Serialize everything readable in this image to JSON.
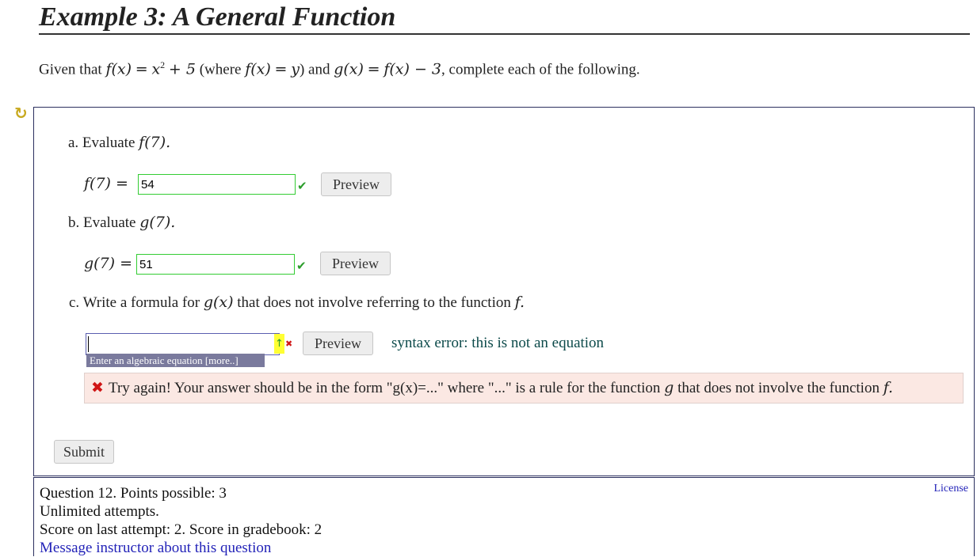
{
  "heading": "Example 3: A General Function",
  "intro": {
    "given": "Given that",
    "f_def_lhs": "f(x)",
    "f_def_rhs_base": "x",
    "f_def_exp": "2",
    "f_def_rhs_rest": "+ 5",
    "where_open": "(where",
    "where_lhs": "f(x)",
    "where_rhs": "y",
    "and": ") and",
    "g_def_lhs": "g(x)",
    "g_def_rhs": "f(x) − 3",
    "tail": ", complete each of the following."
  },
  "icons": {
    "refresh": "refresh-icon",
    "check": "check-icon",
    "cross": "cross-icon",
    "arrow": "up-arrow-icon"
  },
  "part_a": {
    "label_prefix": "a. Evaluate",
    "label_math": "f(7).",
    "eq_label": "f(7) =",
    "value": "54",
    "preview_label": "Preview"
  },
  "part_b": {
    "label_prefix": "b. Evaluate",
    "label_math": "g(7).",
    "eq_label": "g(7) =",
    "value": "51",
    "preview_label": "Preview"
  },
  "part_c": {
    "label_prefix": "c. Write a formula for",
    "label_math": "g(x)",
    "label_mid": "that does not involve referring to the function",
    "label_f": "f.",
    "value": "",
    "hint": "Enter an algebraic equation [more..]",
    "preview_label": "Preview",
    "error": "syntax error: this is not an equation"
  },
  "feedback": {
    "text_start": "Try again! Your answer should be in the form \"g(x)=...\" where \"...\" is a rule for the function",
    "g": "g",
    "text_mid": "that does not involve the function",
    "f": "f."
  },
  "submit_label": "Submit",
  "info": {
    "line1": "Question 12. Points possible: 3",
    "line2": "Unlimited attempts.",
    "line3": "Score on last attempt: 2. Score in gradebook: 2",
    "message_link": "Message instructor about this question",
    "license": "License"
  },
  "colors": {
    "correct_border": "#33cc33",
    "correct_check": "#2a9d2a",
    "error_cross": "#d01515",
    "feedback_bg": "#fbe8e3",
    "link": "#2323b8",
    "hint_bg": "#7a7a9d"
  }
}
